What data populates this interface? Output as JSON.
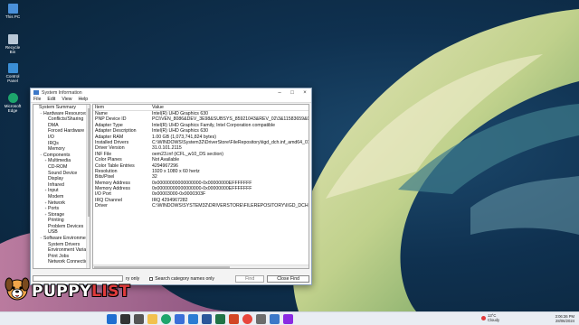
{
  "desktop": {
    "icons": [
      {
        "label": "This PC",
        "icon": "computer-icon"
      },
      {
        "label": "Recycle Bin",
        "icon": "recycle-bin-icon"
      },
      {
        "label": "Control Panel",
        "icon": "control-panel-icon"
      },
      {
        "label": "Microsoft Edge",
        "icon": "edge-icon"
      }
    ]
  },
  "window": {
    "title": "System Information",
    "menu": [
      "File",
      "Edit",
      "View",
      "Help"
    ],
    "tree": [
      {
        "label": "System Summary",
        "level": 0,
        "toggle": ""
      },
      {
        "label": "Hardware Resources",
        "level": 1,
        "toggle": "−"
      },
      {
        "label": "Conflicts/Sharing",
        "level": 2,
        "toggle": ""
      },
      {
        "label": "DMA",
        "level": 2,
        "toggle": ""
      },
      {
        "label": "Forced Hardware",
        "level": 2,
        "toggle": ""
      },
      {
        "label": "I/O",
        "level": 2,
        "toggle": ""
      },
      {
        "label": "IRQs",
        "level": 2,
        "toggle": ""
      },
      {
        "label": "Memory",
        "level": 2,
        "toggle": ""
      },
      {
        "label": "Components",
        "level": 1,
        "toggle": "−"
      },
      {
        "label": "Multimedia",
        "level": 2,
        "toggle": "+"
      },
      {
        "label": "CD-ROM",
        "level": 2,
        "toggle": ""
      },
      {
        "label": "Sound Device",
        "level": 2,
        "toggle": ""
      },
      {
        "label": "Display",
        "level": 2,
        "toggle": ""
      },
      {
        "label": "Infrared",
        "level": 2,
        "toggle": ""
      },
      {
        "label": "Input",
        "level": 2,
        "toggle": "+"
      },
      {
        "label": "Modem",
        "level": 2,
        "toggle": ""
      },
      {
        "label": "Network",
        "level": 2,
        "toggle": "+"
      },
      {
        "label": "Ports",
        "level": 2,
        "toggle": "+"
      },
      {
        "label": "Storage",
        "level": 2,
        "toggle": "+"
      },
      {
        "label": "Printing",
        "level": 2,
        "toggle": ""
      },
      {
        "label": "Problem Devices",
        "level": 2,
        "toggle": ""
      },
      {
        "label": "USB",
        "level": 2,
        "toggle": ""
      },
      {
        "label": "Software Environment",
        "level": 1,
        "toggle": "−"
      },
      {
        "label": "System Drivers",
        "level": 2,
        "toggle": ""
      },
      {
        "label": "Environment Variables",
        "level": 2,
        "toggle": ""
      },
      {
        "label": "Print Jobs",
        "level": 2,
        "toggle": ""
      },
      {
        "label": "Network Connections",
        "level": 2,
        "toggle": ""
      }
    ],
    "table": {
      "headers": [
        "Item",
        "Value"
      ],
      "rows": [
        [
          "Name",
          "Intel(R) UHD Graphics 630"
        ],
        [
          "PNP Device ID",
          "PCI\\VEN_8086&DEV_3E98&SUBSYS_85921043&REV_02\\3&11583659&0&10"
        ],
        [
          "Adapter Type",
          "Intel(R) UHD Graphics Family, Intel Corporation compatible"
        ],
        [
          "Adapter Description",
          "Intel(R) UHD Graphics 630"
        ],
        [
          "Adapter RAM",
          "1.00 GB (1,073,741,824 bytes)"
        ],
        [
          "Installed Drivers",
          "C:\\WINDOWS\\System32\\DriverStore\\FileRepository\\iigd_dch.inf_amd64_01a51642d5f..."
        ],
        [
          "Driver Version",
          "31.0.101.2115"
        ],
        [
          "INF File",
          "oem23.inf (iCFL_w10_DS section)"
        ],
        [
          "Color Planes",
          "Not Available"
        ],
        [
          "Color Table Entries",
          "4294967296"
        ],
        [
          "Resolution",
          "1920 x 1080 x 60 hertz"
        ],
        [
          "Bits/Pixel",
          "32"
        ],
        [
          "Memory Address",
          "0x00000000000000000-0x00000000EFFFFFFF"
        ],
        [
          "Memory Address",
          "0x00000000000000000-0x00000000EFFFFFFF"
        ],
        [
          "I/O Port",
          "0x00003000-0x0000303F"
        ],
        [
          "IRQ Channel",
          "IRQ 4294967282"
        ],
        [
          "Driver",
          "C:\\WINDOWS\\SYSTEM32\\DRIVERSTORE\\FILEREPOSITORY\\IIGD_DCH.INF_AMD64_01A51642..."
        ]
      ]
    },
    "find": {
      "selected_only_label": "ry only",
      "category_names_label": "Search category names only",
      "find_button": "Find",
      "close_find_button": "Close Find"
    }
  },
  "taskbar": {
    "apps": [
      "windows-start-icon",
      "search-icon",
      "task-view-icon",
      "file-explorer-icon",
      "edge-icon",
      "store-icon",
      "mail-icon",
      "word-icon",
      "excel-icon",
      "powerpoint-icon",
      "chrome-icon",
      "settings-icon",
      "system-info-icon",
      "media-icon"
    ],
    "weather_temp": "13°C",
    "weather_desc": "Cloudy",
    "time": "3:06:36 PM",
    "date": "28/06/2024"
  },
  "watermark": {
    "text_main": "PUPPY",
    "text_accent": "LIST"
  },
  "colors": {
    "taskbar_bg": "#e9edf3",
    "window_border": "#8aa0b8",
    "accent_red": "#e03b3b"
  }
}
